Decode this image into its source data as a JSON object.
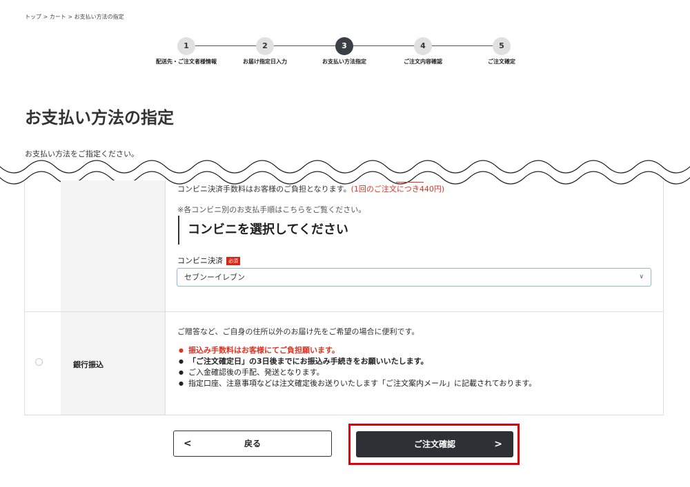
{
  "breadcrumb": "トップ > カート > お支払い方法の指定",
  "steps": [
    {
      "num": "1",
      "label": "配送先・ご注文者様情報"
    },
    {
      "num": "2",
      "label": "お届け指定日入力"
    },
    {
      "num": "3",
      "label": "お支払い方法指定"
    },
    {
      "num": "4",
      "label": "ご注文内容確認"
    },
    {
      "num": "5",
      "label": "ご注文確定"
    }
  ],
  "page": {
    "title": "お支払い方法の指定",
    "description": "お支払い方法をご指定ください。"
  },
  "convenience": {
    "fee_note": "コンビニ決済手数料はお客様のご負担となります。",
    "fee_amount": "(1回のご注文につき440円)",
    "guide_note": "※各コンビニ別のお支払手順はこちらをご覧ください。",
    "select_heading": "コンビニを選択してください",
    "field_label": "コンビニ決済",
    "required": "必須",
    "selected_value": "セブンーイレブン"
  },
  "bank": {
    "label": "銀行振込",
    "description": "ご贈答など、ご自身の住所以外のお届け先をご希望の場合に便利です。",
    "notes": [
      "振込み手数料はお客様にてご負担願います。",
      "「ご注文確定日」の3日後までにお振込み手続きをお願いいたします。",
      "ご入金確認後の手配、発送となります。",
      "指定口座、注意事項などは注文確定後お送りいたします「ご注文案内メール」に記載されております。"
    ]
  },
  "buttons": {
    "back": "戻る",
    "confirm": "ご注文確認"
  },
  "colors": {
    "accent_red": "#d32222",
    "dark_button": "#2d3035",
    "highlight": "#e0000b"
  }
}
